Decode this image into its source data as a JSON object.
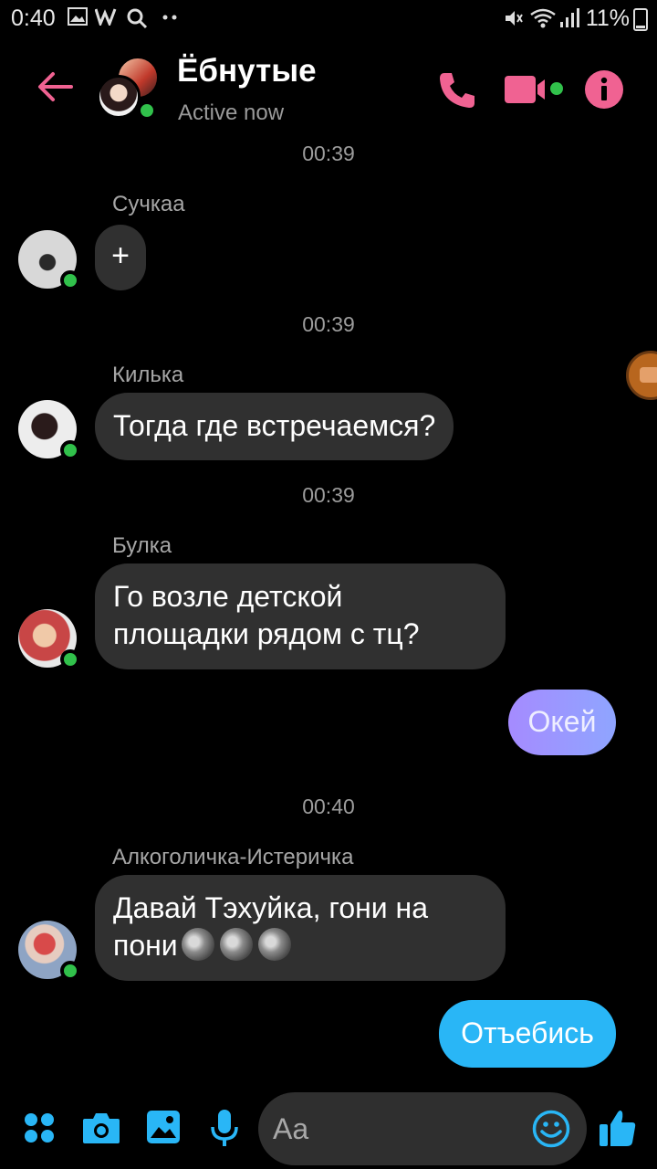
{
  "status_bar": {
    "time": "0:40",
    "battery": "11%"
  },
  "header": {
    "title": "Ёбнутые",
    "subtitle": "Active now"
  },
  "messages": [
    {
      "timestamp": "00:39",
      "sender": "Сучкаа",
      "text": "+"
    },
    {
      "timestamp": "00:39",
      "sender": "Килька",
      "text": "Тогда где встречаемся?"
    },
    {
      "timestamp": "00:39",
      "sender": "Булка",
      "line1": "Го возле детской",
      "line2": "площадки рядом с тц?"
    },
    {
      "outgoing": true,
      "text": "Окей"
    },
    {
      "timestamp": "00:40",
      "sender": "Алкоголичка-Истеричка",
      "line1": "Давай Тэхуйка, гони на",
      "line2": "пони"
    },
    {
      "outgoing": true,
      "text": "Отъебись"
    }
  ],
  "composer": {
    "placeholder": "Aa"
  },
  "colors": {
    "accent_pink": "#f06292",
    "online_green": "#31c14b",
    "outgoing_purple": "#a58bff",
    "outgoing_blue": "#29b6f6",
    "composer_blue": "#29b6f6"
  },
  "icons": [
    "back-arrow-icon",
    "phone-icon",
    "video-icon",
    "info-icon",
    "menu-dots-icon",
    "camera-icon",
    "gallery-icon",
    "microphone-icon",
    "emoji-icon",
    "thumbs-up-icon"
  ]
}
